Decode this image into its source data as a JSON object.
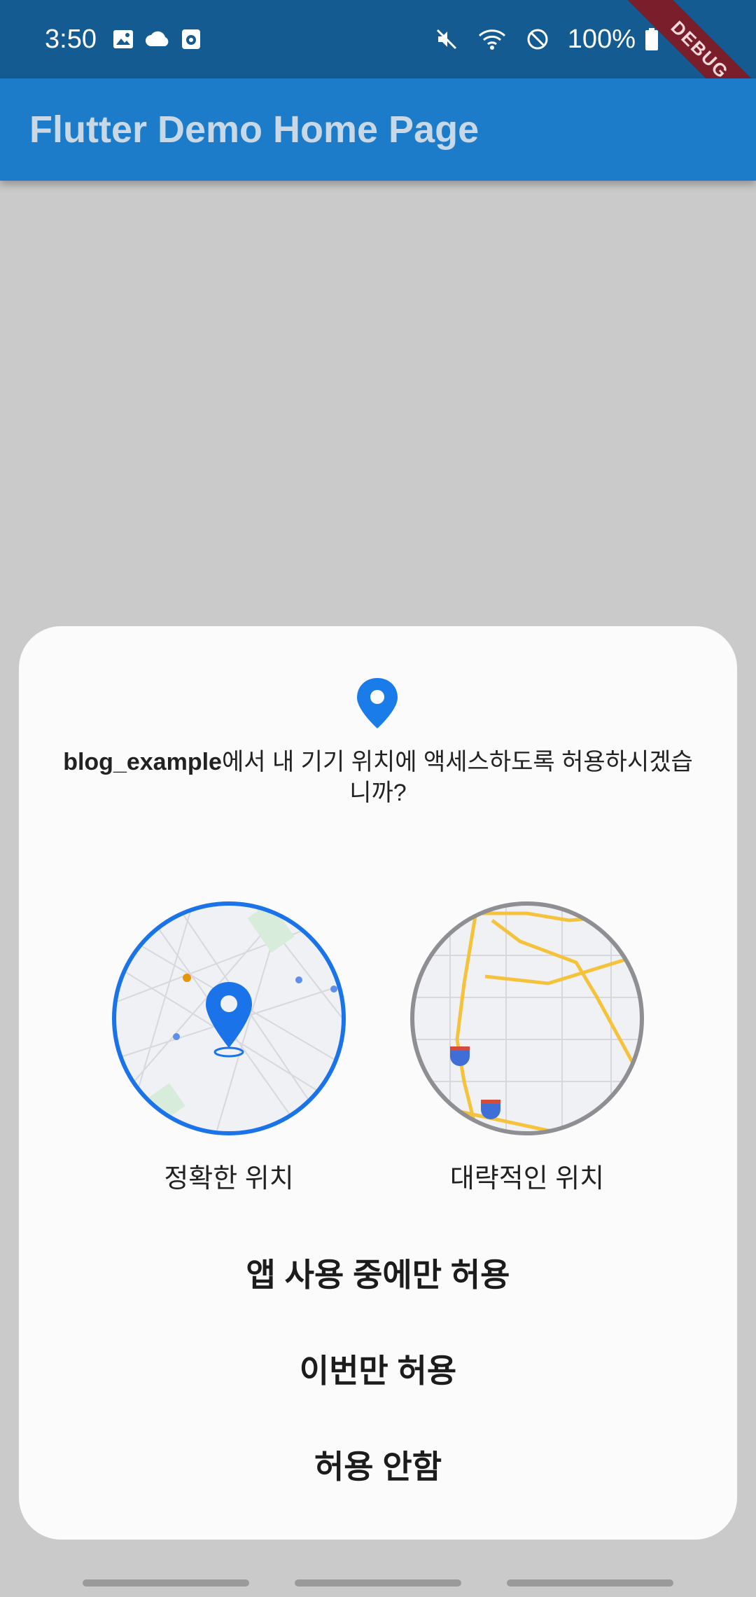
{
  "status_bar": {
    "time": "3:50",
    "left_icons": [
      "image-icon",
      "cloud-icon",
      "app-notification-icon"
    ],
    "right_icons": [
      "mute-icon",
      "wifi-icon",
      "do-not-disturb-icon",
      "battery-icon"
    ],
    "battery": "100%"
  },
  "app_bar": {
    "title": "Flutter Demo Home Page",
    "color": "#1d7cc9"
  },
  "debug_banner": "DEBUG",
  "dialog": {
    "app_name": "blog_example",
    "prompt_rest": "에서 내 기기 위치에 액세스하도록 허용하시겠습니까?",
    "options": [
      {
        "label": "정확한 위치",
        "selected": true
      },
      {
        "label": "대략적인 위치",
        "selected": false
      }
    ],
    "actions": {
      "while_using": "앱 사용 중에만 허용",
      "only_this_time": "이번만 허용",
      "deny": "허용 안함"
    },
    "accent_color": "#1a73e8"
  }
}
